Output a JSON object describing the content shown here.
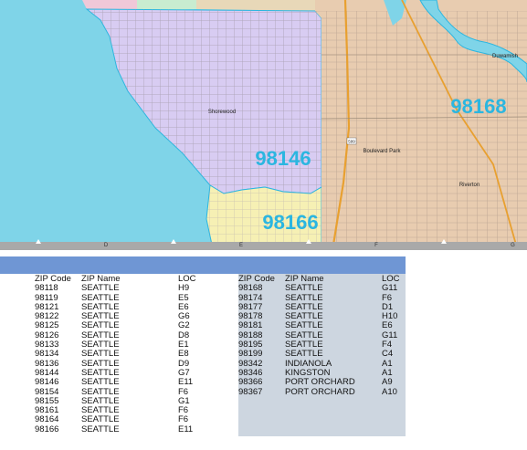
{
  "map": {
    "zip_labels": [
      "98168",
      "98146",
      "98166"
    ],
    "place_labels": [
      "Shorewood",
      "Boulevard Park",
      "Riverton",
      "Duwamish"
    ],
    "route_badge": "599",
    "colors": {
      "water": "#7fd4e8",
      "zone_98146": "#d8ccf2",
      "zone_98168": "#e8ccb0",
      "zone_98166": "#f6f0b4",
      "zip_label": "#2bb6e0",
      "freeway": "#e8a030"
    }
  },
  "grid_columns": [
    "D",
    "E",
    "F",
    "G"
  ],
  "table_headers": {
    "zip": "ZIP Code",
    "name": "ZIP Name",
    "loc": "LOC"
  },
  "table_left": [
    {
      "zip": "98118",
      "name": "SEATTLE",
      "loc": "H9"
    },
    {
      "zip": "98119",
      "name": "SEATTLE",
      "loc": "E5"
    },
    {
      "zip": "98121",
      "name": "SEATTLE",
      "loc": "E6"
    },
    {
      "zip": "98122",
      "name": "SEATTLE",
      "loc": "G6"
    },
    {
      "zip": "98125",
      "name": "SEATTLE",
      "loc": "G2"
    },
    {
      "zip": "98126",
      "name": "SEATTLE",
      "loc": "D8"
    },
    {
      "zip": "98133",
      "name": "SEATTLE",
      "loc": "E1"
    },
    {
      "zip": "98134",
      "name": "SEATTLE",
      "loc": "E8"
    },
    {
      "zip": "98136",
      "name": "SEATTLE",
      "loc": "D9"
    },
    {
      "zip": "98144",
      "name": "SEATTLE",
      "loc": "G7"
    },
    {
      "zip": "98146",
      "name": "SEATTLE",
      "loc": "E11"
    },
    {
      "zip": "98154",
      "name": "SEATTLE",
      "loc": "F6"
    },
    {
      "zip": "98155",
      "name": "SEATTLE",
      "loc": "G1"
    },
    {
      "zip": "98161",
      "name": "SEATTLE",
      "loc": "F6"
    },
    {
      "zip": "98164",
      "name": "SEATTLE",
      "loc": "F6"
    },
    {
      "zip": "98166",
      "name": "SEATTLE",
      "loc": "E11"
    }
  ],
  "table_right": [
    {
      "zip": "98168",
      "name": "SEATTLE",
      "loc": "G11"
    },
    {
      "zip": "98174",
      "name": "SEATTLE",
      "loc": "F6"
    },
    {
      "zip": "98177",
      "name": "SEATTLE",
      "loc": "D1"
    },
    {
      "zip": "98178",
      "name": "SEATTLE",
      "loc": "H10"
    },
    {
      "zip": "98181",
      "name": "SEATTLE",
      "loc": "E6"
    },
    {
      "zip": "98188",
      "name": "SEATTLE",
      "loc": "G11"
    },
    {
      "zip": "98195",
      "name": "SEATTLE",
      "loc": "F4"
    },
    {
      "zip": "98199",
      "name": "SEATTLE",
      "loc": "C4"
    },
    {
      "zip": "98342",
      "name": "INDIANOLA",
      "loc": "A1"
    },
    {
      "zip": "98346",
      "name": "KINGSTON",
      "loc": "A1"
    },
    {
      "zip": "98366",
      "name": "PORT ORCHARD",
      "loc": "A9"
    },
    {
      "zip": "98367",
      "name": "PORT ORCHARD",
      "loc": "A10"
    }
  ]
}
